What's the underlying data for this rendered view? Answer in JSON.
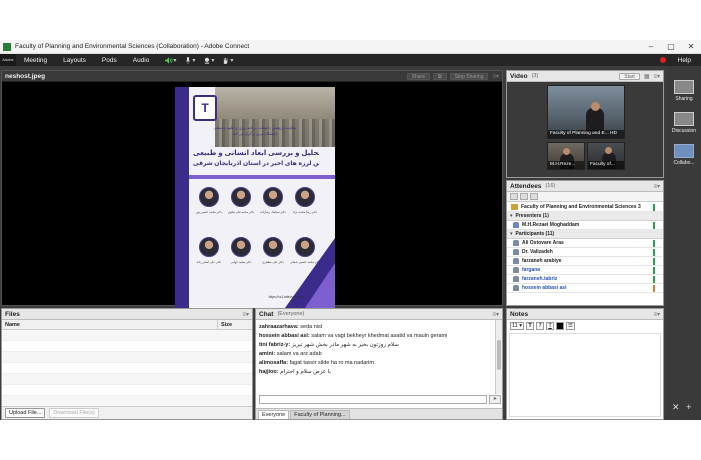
{
  "window": {
    "title": "Faculty of Planning and Environmental Sciences (Collaboration) - Adobe Connect",
    "controls": [
      "–",
      "▢",
      "✕"
    ]
  },
  "menubar": {
    "logo": "Adobe",
    "items": [
      "Meeting",
      "Layouts",
      "Pods",
      "Audio"
    ],
    "help": "Help"
  },
  "share_pod": {
    "title": "neshost.jpeg",
    "share_label": "Share",
    "stop_label": "Stop Sharing",
    "poster": {
      "header_line1": "معاونت پژوهش دانشکده برنامه ریزی و علوم محیطی",
      "header_line2": "دانشگاه تبریز برگزار می کند",
      "title_line1": "تحلیل و بررسی ابعاد انسانی و طبیعی",
      "title_line2": "زمین لرزه های اخیر در استان آذربایجان شرقی",
      "names_row1": [
        "دکتر محمد حسین پور",
        "دکتر محمدعلی نیکوی",
        "دکتر سیامک رضازاده",
        "دکتر رضا محمد نژاد"
      ],
      "names_row2": [
        "دکتر علی اصغر زاده",
        "دکتر سعید جهانی",
        "دکتر علی مظفری",
        "دکتر محمد حسین شیخی"
      ],
      "footer": "https://vc1.tabrizu.ac.ir/pp"
    }
  },
  "video_pod": {
    "title": "Video",
    "count": "(3)",
    "start_label": "Start",
    "tiles": [
      {
        "label": "Faculty of Planning and E... HD"
      },
      {
        "label": "M.H.Reze..."
      },
      {
        "label": "Faculty of..."
      }
    ]
  },
  "attendees_pod": {
    "title": "Attendees",
    "count": "(16)",
    "host": "Faculty of Planning and Environmental Sciences 3",
    "presenters_group": "Presenters (1)",
    "presenters": [
      "M.H.Rezaei Moghaddam"
    ],
    "participants_group": "Participants (11)",
    "participants": [
      {
        "name": "Ali Ostovare Aras",
        "highlight": false,
        "status": "#21a84a"
      },
      {
        "name": "Dr. Valizadeh",
        "highlight": false,
        "status": "#21a84a"
      },
      {
        "name": "farzaneh arabiye",
        "highlight": false,
        "status": "#21a84a"
      },
      {
        "name": "fargana",
        "highlight": true,
        "status": "#21a84a"
      },
      {
        "name": "farzaneh.tabriz",
        "highlight": true,
        "status": "#21a84a"
      },
      {
        "name": "hossein abbasi asl",
        "highlight": true,
        "status": "#e07a2a"
      }
    ]
  },
  "files_pod": {
    "title": "Files",
    "col_name": "Name",
    "col_size": "Size",
    "upload_label": "Upload File...",
    "download_label": "Download File(s)"
  },
  "chat_pod": {
    "title": "Chat",
    "scope": "(Everyone)",
    "messages": [
      {
        "sender": "zahraazarhava:",
        "text": " seda nist"
      },
      {
        "sender": "hossein abbasi asl:",
        "text": " salam va vagt bekheyr khedmat asatid va mauln gerami"
      },
      {
        "sender": "tini fabriz-y:",
        "text": " سلام روزتون بخیر به شهر مادر بخش شهر تبریز"
      },
      {
        "sender": "amini:",
        "text": " salam va arz adab"
      },
      {
        "sender": "alimosaffa:",
        "text": " fagat tasvir silde ha ro ma nadarim"
      },
      {
        "sender": "hajjioo:",
        "text": " با عرض سلام و احترام"
      }
    ],
    "tabs": [
      "Everyone",
      "Faculty of Planning..."
    ],
    "send_label": "➤"
  },
  "notes_pod": {
    "title": "Notes",
    "font_size": "11 ▾",
    "bold": "T",
    "italic": "T",
    "underline": "T"
  },
  "rightbar": {
    "items": [
      "Sharing",
      "Discussion",
      "Collabo..."
    ],
    "layouts_label": "Tk"
  },
  "colors": {
    "accent_purple": "#3b2c8c",
    "menubar_bg": "#262626",
    "status_green": "#21a84a",
    "status_orange": "#e07a2a",
    "link_blue": "#2855b8"
  }
}
